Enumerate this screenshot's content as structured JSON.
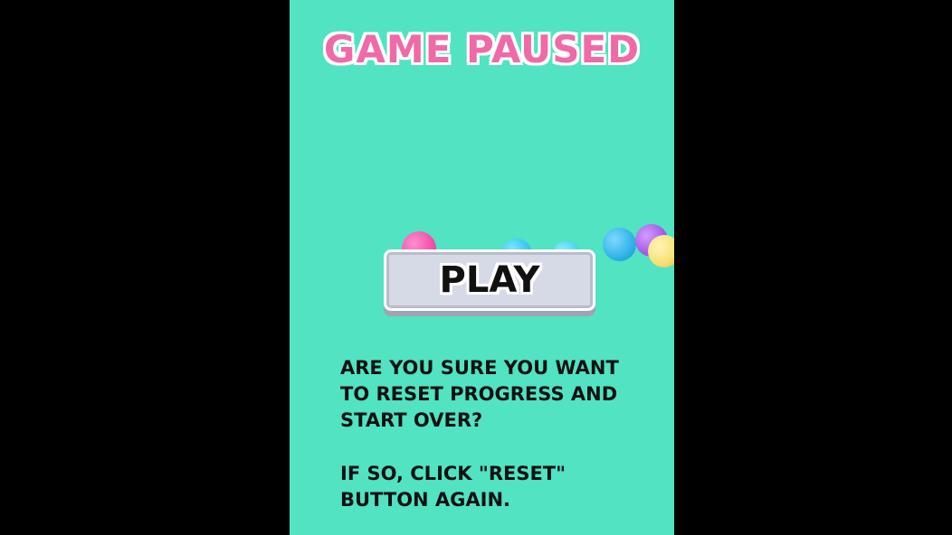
{
  "screen": {
    "title": "GAME PAUSED",
    "play_button_label": "PLAY",
    "message_line1": "ARE YOU SURE YOU WANT TO RESET PROGRESS AND START OVER?",
    "message_line2": "IF SO, CLICK \"RESET\" BUTTON AGAIN."
  },
  "colors": {
    "background": "#51e3c2",
    "title": "#f06aa8",
    "button": "#d6d9e6",
    "letterbox": "#000000"
  },
  "balls": [
    "pink",
    "blue",
    "blue",
    "blue",
    "purple",
    "yellow"
  ]
}
